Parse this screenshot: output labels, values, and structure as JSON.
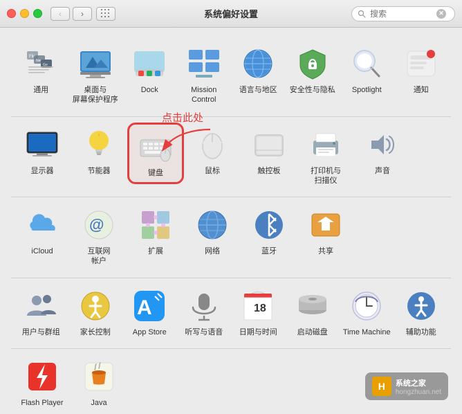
{
  "window": {
    "title": "系统偏好设置",
    "search_placeholder": "搜索"
  },
  "nav": {
    "back_label": "‹",
    "forward_label": "›"
  },
  "annotation": {
    "text": "点击此处"
  },
  "rows": [
    {
      "id": "row1",
      "items": [
        {
          "id": "general",
          "label": "通用",
          "icon_type": "general"
        },
        {
          "id": "desktop",
          "label": "桌面与\n屏幕保护程序",
          "icon_type": "desktop"
        },
        {
          "id": "dock",
          "label": "Dock",
          "icon_type": "dock"
        },
        {
          "id": "mission_control",
          "label": "Mission\nControl",
          "icon_type": "mission_control"
        },
        {
          "id": "language",
          "label": "语言与地区",
          "icon_type": "language"
        },
        {
          "id": "security",
          "label": "安全性与隐私",
          "icon_type": "security"
        },
        {
          "id": "spotlight",
          "label": "Spotlight",
          "icon_type": "spotlight"
        },
        {
          "id": "notifications",
          "label": "通知",
          "icon_type": "notifications"
        }
      ]
    },
    {
      "id": "row2",
      "items": [
        {
          "id": "display",
          "label": "显示器",
          "icon_type": "display"
        },
        {
          "id": "energy",
          "label": "节能器",
          "icon_type": "energy"
        },
        {
          "id": "keyboard",
          "label": "键盘",
          "icon_type": "keyboard",
          "highlighted": true
        },
        {
          "id": "mouse",
          "label": "鼠标",
          "icon_type": "mouse"
        },
        {
          "id": "trackpad",
          "label": "触控板",
          "icon_type": "trackpad"
        },
        {
          "id": "printer",
          "label": "打印机与\n扫描仪",
          "icon_type": "printer"
        },
        {
          "id": "sound",
          "label": "声音",
          "icon_type": "sound"
        }
      ]
    },
    {
      "id": "row3",
      "items": [
        {
          "id": "icloud",
          "label": "iCloud",
          "icon_type": "icloud"
        },
        {
          "id": "internet",
          "label": "互联网\n帐户",
          "icon_type": "internet"
        },
        {
          "id": "extensions",
          "label": "扩展",
          "icon_type": "extensions"
        },
        {
          "id": "network",
          "label": "网络",
          "icon_type": "network"
        },
        {
          "id": "bluetooth",
          "label": "蓝牙",
          "icon_type": "bluetooth"
        },
        {
          "id": "sharing",
          "label": "共享",
          "icon_type": "sharing"
        }
      ]
    },
    {
      "id": "row4",
      "items": [
        {
          "id": "users",
          "label": "用户与群组",
          "icon_type": "users"
        },
        {
          "id": "parental",
          "label": "家长控制",
          "icon_type": "parental"
        },
        {
          "id": "appstore",
          "label": "App Store",
          "icon_type": "appstore"
        },
        {
          "id": "dictation",
          "label": "听写与语音",
          "icon_type": "dictation"
        },
        {
          "id": "datetime",
          "label": "日期与时间",
          "icon_type": "datetime"
        },
        {
          "id": "startup",
          "label": "启动磁盘",
          "icon_type": "startup"
        },
        {
          "id": "timemachine",
          "label": "Time Machine",
          "icon_type": "timemachine"
        },
        {
          "id": "accessibility",
          "label": "辅助功能",
          "icon_type": "accessibility"
        }
      ]
    },
    {
      "id": "row5",
      "items": [
        {
          "id": "flashplayer",
          "label": "Flash Player",
          "icon_type": "flashplayer"
        },
        {
          "id": "java",
          "label": "Java",
          "icon_type": "java"
        }
      ]
    }
  ],
  "watermark": {
    "site": "系统之家",
    "url": "hongzhuan.net"
  }
}
